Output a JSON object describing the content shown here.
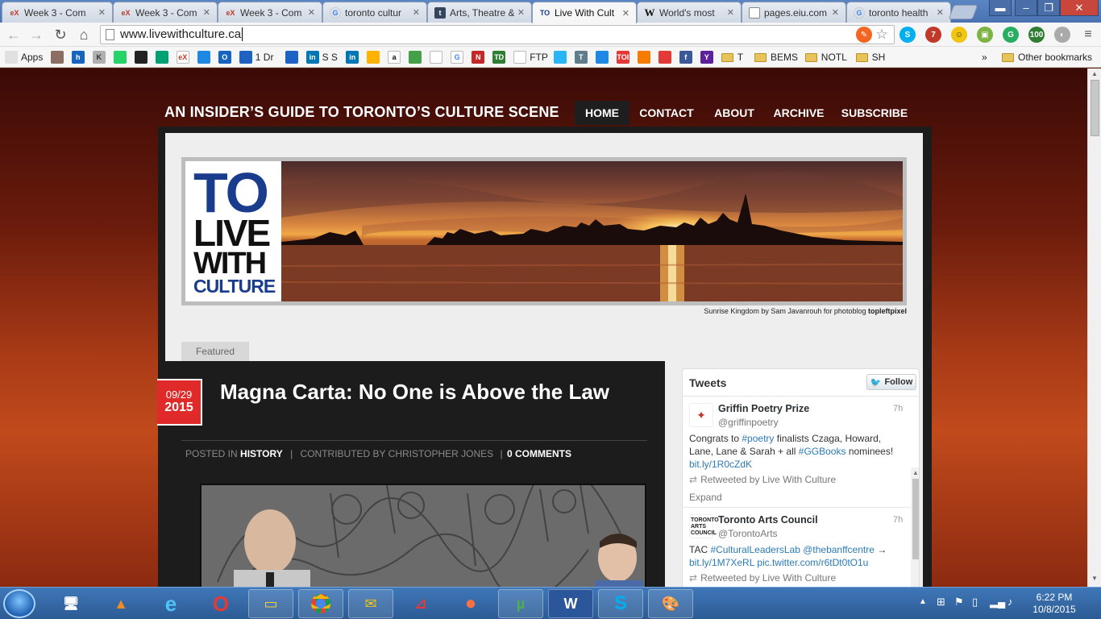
{
  "browser": {
    "tabs": [
      {
        "label": "Week 3 - Com",
        "icon": "edx-icon"
      },
      {
        "label": "Week 3 - Com",
        "icon": "edx-icon"
      },
      {
        "label": "Week 3 - Com",
        "icon": "edx-icon"
      },
      {
        "label": "toronto cultur",
        "icon": "google-icon"
      },
      {
        "label": "Arts, Theatre &",
        "icon": "tumblr-icon"
      },
      {
        "label": "Live With Cult",
        "icon": "tlwc-icon",
        "icon_text": "TO"
      },
      {
        "label": "World's most",
        "icon": "wikipedia-icon",
        "icon_text": "W"
      },
      {
        "label": "pages.eiu.com",
        "icon": "page-icon"
      },
      {
        "label": "toronto health",
        "icon": "google-icon"
      }
    ],
    "url": "www.livewithculture.ca",
    "bookmarks": [
      {
        "label": "Apps",
        "icon": "apps-icon"
      },
      {
        "label": "",
        "icon": "avatar-icon"
      },
      {
        "label": "",
        "icon": "hootsuite-icon",
        "icon_text": "h"
      },
      {
        "label": "",
        "icon": "klout-icon",
        "icon_text": "K"
      },
      {
        "label": "",
        "icon": "whatsapp-icon"
      },
      {
        "label": "",
        "icon": "camera-icon"
      },
      {
        "label": "",
        "icon": "play-store-icon"
      },
      {
        "label": "",
        "icon": "edx-icon",
        "icon_text": "eX"
      },
      {
        "label": "",
        "icon": "link-icon"
      },
      {
        "label": "",
        "icon": "outlook-icon",
        "icon_text": "O"
      },
      {
        "label": "1 Dr",
        "icon": "onedrive-icon"
      },
      {
        "label": "",
        "icon": "flag-icon"
      },
      {
        "label": "S S",
        "icon": "linkedin-icon",
        "icon_text": "in"
      },
      {
        "label": "",
        "icon": "linkedin-icon",
        "icon_text": "in"
      },
      {
        "label": "",
        "icon": "dots-icon"
      },
      {
        "label": "",
        "icon": "amazon-icon",
        "icon_text": "a"
      },
      {
        "label": "",
        "icon": "maps-icon"
      },
      {
        "label": "",
        "icon": "home-icon"
      },
      {
        "label": "",
        "icon": "google-icon",
        "icon_text": "G"
      },
      {
        "label": "",
        "icon": "n-icon",
        "icon_text": "N"
      },
      {
        "label": "",
        "icon": "td-icon",
        "icon_text": "TD"
      },
      {
        "label": "FTP",
        "icon": "page-icon"
      },
      {
        "label": "",
        "icon": "sa-icon"
      },
      {
        "label": "",
        "icon": "tz-icon",
        "icon_text": "T"
      },
      {
        "label": "",
        "icon": "dropbox-icon"
      },
      {
        "label": "",
        "icon": "toi-icon",
        "icon_text": "TOI"
      },
      {
        "label": "",
        "icon": "blogger-icon"
      },
      {
        "label": "",
        "icon": "youtube-icon"
      },
      {
        "label": "",
        "icon": "facebook-icon",
        "icon_text": "f"
      },
      {
        "label": "",
        "icon": "yahoo-icon",
        "icon_text": "Y"
      },
      {
        "label": "T",
        "icon": "folder-icon"
      },
      {
        "label": "BEMS",
        "icon": "folder-icon"
      },
      {
        "label": "NOTL",
        "icon": "folder-icon"
      },
      {
        "label": "SH",
        "icon": "folder-icon"
      }
    ],
    "bookmarks_overflow": "»",
    "other_bookmarks": "Other bookmarks"
  },
  "site": {
    "title": "AN INSIDER’S GUIDE TO TORONTO’S CULTURE SCENE",
    "nav": [
      "HOME",
      "CONTACT",
      "ABOUT",
      "ARCHIVE",
      "SUBSCRIBE"
    ],
    "logo_lines": [
      "TO",
      "LIVE",
      "WITH",
      "CULTURE"
    ],
    "banner_credit": "Sunrise Kingdom by Sam Javanrouh for photoblog",
    "banner_credit_bold": "topleftpixel",
    "featured_label": "Featured"
  },
  "post": {
    "date_md": "09/29",
    "date_year": "2015",
    "title": "Magna Carta: No One is Above the Law",
    "posted_in_label": "POSTED IN",
    "category": "HISTORY",
    "contributed_label": "CONTRIBUTED BY CHRISTOPHER JONES",
    "comments": "0 COMMENTS"
  },
  "tweets": {
    "title": "Tweets",
    "follow": "Follow",
    "items": [
      {
        "name": "Griffin Poetry Prize",
        "handle": "@griffinpoetry",
        "time": "7h",
        "text_parts": [
          "Congrats to ",
          "#poetry",
          " finalists Czaga, Howard, Lane, Lane & Sarah + all ",
          "#GGBooks",
          " nominees! ",
          "bit.ly/1R0cZdK"
        ],
        "retweet": "Retweeted by Live With Culture",
        "expand": "Expand"
      },
      {
        "name": "Toronto Arts Council",
        "handle": "@TorontoArts",
        "time": "7h",
        "text_parts": [
          "TAC ",
          "#CulturalLeadersLab",
          " ",
          "@thebanffcentre",
          " → ",
          "bit.ly/1M7XeRL",
          " ",
          "pic.twitter.com/r6tDt0tO1u"
        ],
        "retweet": "Retweeted by Live With Culture"
      }
    ]
  },
  "taskbar": {
    "apps": [
      "ie-icon",
      "vlc-icon",
      "internet-explorer-icon",
      "opera-icon",
      "file-explorer-icon",
      "chrome-icon",
      "outlook-icon",
      "acrobat-icon",
      "firefox-icon",
      "utorrent-icon",
      "word-icon",
      "skype-icon",
      "paint-icon"
    ],
    "time": "6:22 PM",
    "date": "10/8/2015"
  },
  "colors": {
    "accent_red": "#e02a2a",
    "tab_bar": "#4a72b0",
    "link": "#2b7bb9"
  }
}
